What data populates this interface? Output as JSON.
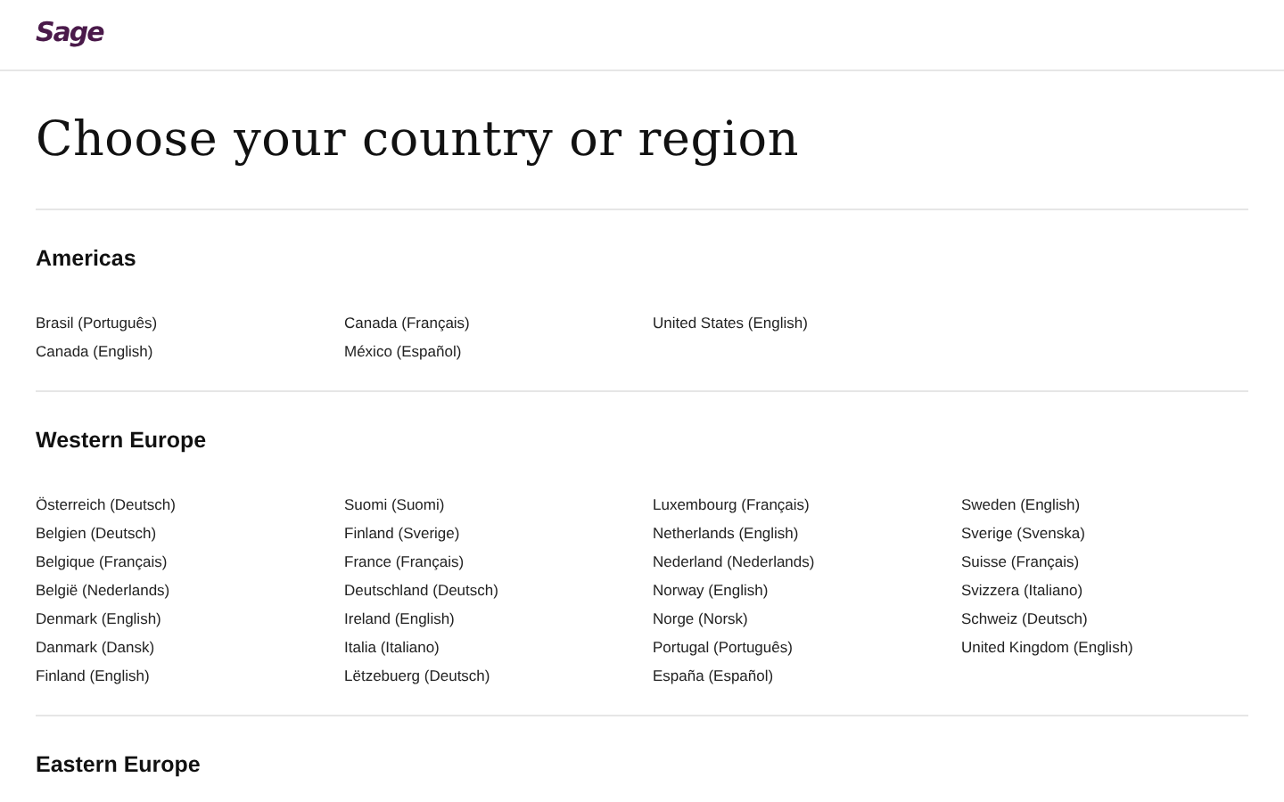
{
  "header": {
    "logo": "Sage"
  },
  "title": "Choose your country or region",
  "regions": [
    {
      "name": "Americas",
      "columns": [
        [
          "Brasil (Português)",
          "Canada (English)"
        ],
        [
          "Canada (Français)",
          "México (Español)"
        ],
        [
          "United States (English)"
        ]
      ]
    },
    {
      "name": "Western Europe",
      "columns": [
        [
          "Österreich (Deutsch)",
          "Belgien (Deutsch)",
          "Belgique (Français)",
          "België (Nederlands)",
          "Denmark (English)",
          "Danmark (Dansk)",
          "Finland (English)"
        ],
        [
          "Suomi (Suomi)",
          "Finland (Sverige)",
          "France (Français)",
          "Deutschland (Deutsch)",
          "Ireland (English)",
          "Italia (Italiano)",
          "Lëtzebuerg (Deutsch)"
        ],
        [
          "Luxembourg (Français)",
          "Netherlands (English)",
          "Nederland (Nederlands)",
          "Norway (English)",
          "Norge (Norsk)",
          "Portugal (Português)",
          "España (Español)"
        ],
        [
          "Sweden (English)",
          "Sverige (Svenska)",
          "Suisse (Français)",
          "Svizzera (Italiano)",
          "Schweiz (Deutsch)",
          "United Kingdom (English)"
        ]
      ]
    },
    {
      "name": "Eastern Europe"
    }
  ]
}
